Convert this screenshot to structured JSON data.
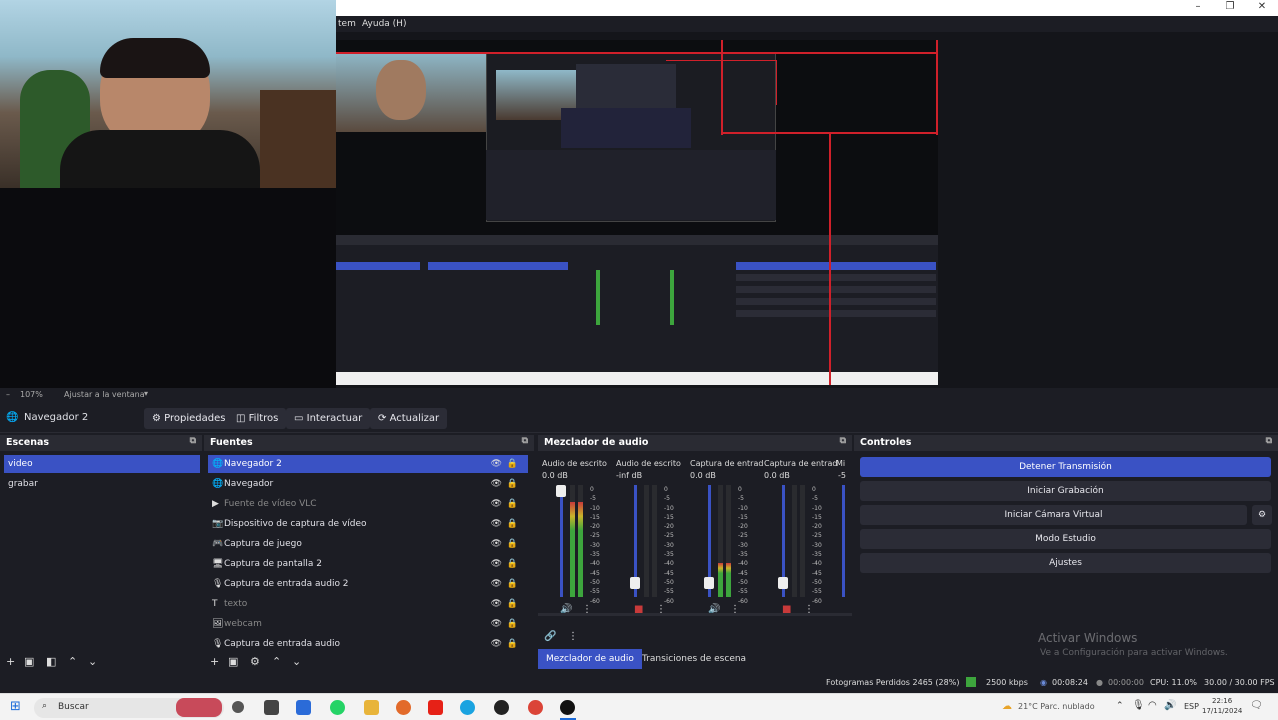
{
  "menu": {
    "item1": "tem",
    "item2": "Ayuda (H)"
  },
  "preview": {
    "zoom": "107%",
    "fit": "Ajustar a la ventana"
  },
  "source_toolbar": {
    "selected_source": "Navegador 2",
    "properties": "Propiedades",
    "filters": "Filtros",
    "interact": "Interactuar",
    "refresh": "Actualizar"
  },
  "scenes": {
    "title": "Escenas",
    "items": [
      "video",
      "grabar"
    ]
  },
  "sources": {
    "title": "Fuentes",
    "items": [
      {
        "label": "Navegador 2",
        "icon": "browser-icon"
      },
      {
        "label": "Navegador",
        "icon": "browser-icon"
      },
      {
        "label": "Fuente de vídeo VLC",
        "icon": "play-icon"
      },
      {
        "label": "Dispositivo de captura de vídeo",
        "icon": "camera-icon"
      },
      {
        "label": "Captura de juego",
        "icon": "gamepad-icon"
      },
      {
        "label": "Captura de pantalla 2",
        "icon": "monitor-icon"
      },
      {
        "label": "Captura de entrada audio 2",
        "icon": "microphone-icon"
      },
      {
        "label": "texto",
        "icon": "text-icon"
      },
      {
        "label": "webcam",
        "icon": "image-icon"
      },
      {
        "label": "Captura de entrada audio",
        "icon": "microphone-icon"
      }
    ]
  },
  "mixer": {
    "title": "Mezclador de audio",
    "channels": [
      {
        "label": "Audio de escrito",
        "db": "0.0 dB",
        "level": 0.85
      },
      {
        "label": "Audio de escrito",
        "db": "-inf dB",
        "level": 0.0
      },
      {
        "label": "Captura de entrad",
        "db": "0.0 dB",
        "level": 0.3
      },
      {
        "label": "Captura de entrad",
        "db": "0.0 dB",
        "level": 0.0
      }
    ],
    "extra_label": "Mi",
    "extra_db": "-5",
    "ticks": [
      "0",
      "-5",
      "-10",
      "-15",
      "-20",
      "-25",
      "-30",
      "-35",
      "-40",
      "-45",
      "-50",
      "-55",
      "-60"
    ]
  },
  "controls": {
    "title": "Controles",
    "buttons": [
      "Detener Transmisión",
      "Iniciar Grabación",
      "Iniciar Cámara Virtual",
      "Modo Estudio",
      "Ajustes"
    ]
  },
  "bottom_tabs": {
    "mixer": "Mezclador de audio",
    "transitions": "Transiciones de escena"
  },
  "watermark": {
    "title": "Activar Windows",
    "subtitle": "Ve a Configuración para activar Windows."
  },
  "status": {
    "dropped": "Fotogramas Perdidos 2465 (28%)",
    "bitrate": "2500 kbps",
    "live_time": "00:08:24",
    "rec_time": "00:00:00",
    "cpu": "CPU: 11.0%",
    "fps": "30.00 / 30.00 FPS"
  },
  "taskbar": {
    "search": "Buscar",
    "weather": "21°C  Parc. nublado",
    "lang": "ESP",
    "time": "22:16",
    "date": "17/11/2024"
  }
}
